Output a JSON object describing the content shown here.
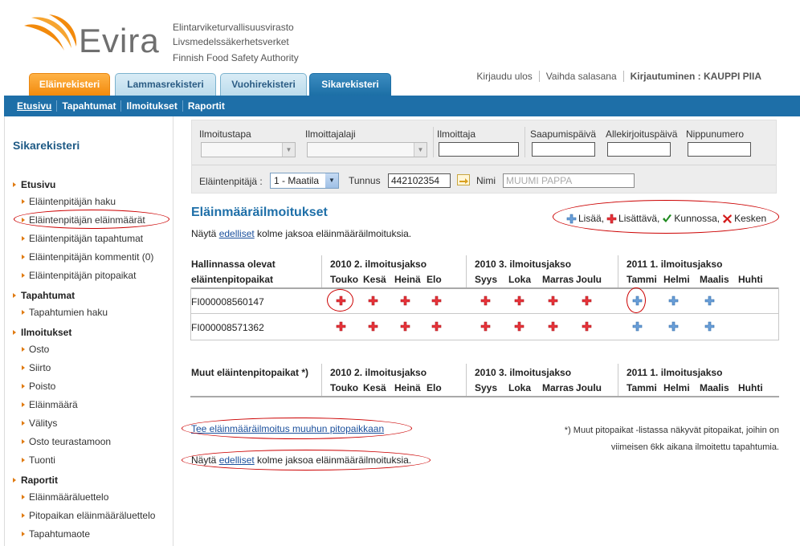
{
  "brand": {
    "logo_text": "Evira",
    "agency_fi": "Elintarviketurvallisuusvirasto",
    "agency_sv": "Livsmedelssäkerhetsverket",
    "agency_en": "Finnish Food Safety Authority",
    "colors": {
      "orange": "#f28a0c",
      "blue": "#1e6fa8",
      "gray": "#6f6f6f"
    }
  },
  "tabs": [
    "Eläinrekisteri",
    "Lammasrekisteri",
    "Vuohirekisteri",
    "Sikarekisteri"
  ],
  "toplinks": {
    "logout": "Kirjaudu ulos",
    "change_password": "Vaihda salasana",
    "login_info": "Kirjautuminen : KAUPPI PIIA"
  },
  "nav": [
    "Etusivu",
    "Tapahtumat",
    "Ilmoitukset",
    "Raportit"
  ],
  "sidebar": {
    "title": "Sikarekisteri",
    "sections": [
      {
        "label": "Etusivu",
        "items": [
          "Eläintenpitäjän haku",
          "Eläintenpitäjän eläinmäärät",
          "Eläintenpitäjän tapahtumat",
          "Eläintenpitäjän kommentit (0)",
          "Eläintenpitäjän pitopaikat"
        ]
      },
      {
        "label": "Tapahtumat",
        "items": [
          "Tapahtumien haku"
        ]
      },
      {
        "label": "Ilmoitukset",
        "items": [
          "Osto",
          "Siirto",
          "Poisto",
          "Eläinmäärä",
          "Välitys",
          "Osto teurastamoon",
          "Tuonti"
        ]
      },
      {
        "label": "Raportit",
        "items": [
          "Eläinmääräluettelo",
          "Pitopaikan eläinmääräluettelo",
          "Tapahtumaote"
        ]
      }
    ]
  },
  "filter": {
    "ilmoitustapa_label": "Ilmoitustapa",
    "ilmoittajalaji_label": "Ilmoittajalaji",
    "ilmoittaja_label": "Ilmoittaja",
    "saapumispaiva_label": "Saapumispäivä",
    "allekirjoituspaiva_label": "Allekirjoituspäivä",
    "nippunumero_label": "Nippunumero",
    "owner_label": "Eläintenpitäjä :",
    "owner_value": "1 - Maatila",
    "tunnus_label": "Tunnus",
    "tunnus_value": "442102354",
    "nimi_label": "Nimi",
    "nimi_value": "MUUMI PAPPA"
  },
  "main": {
    "title": "Eläinmääräilmoitukset",
    "show_prefix": "Näytä ",
    "show_link": "edelliset",
    "show_suffix": " kolme jaksoa eläinmääräilmoituksia.",
    "legend": {
      "add": "Lisää,",
      "supplement": "Lisättävä,",
      "ok": "Kunnossa,",
      "incomplete": "Kesken"
    },
    "table1_header": [
      "Hallinnassa olevat",
      "eläintenpitopaikat"
    ],
    "table2_header": "Muut eläintenpitopaikat *)",
    "periods": [
      {
        "title": "2010 2. ilmoitusjakso",
        "months": [
          "Touko",
          "Kesä",
          "Heinä",
          "Elo"
        ]
      },
      {
        "title": "2010 3. ilmoitusjakso",
        "months": [
          "Syys",
          "Loka",
          "Marras",
          "Joulu"
        ]
      },
      {
        "title": "2011 1. ilmoitusjakso",
        "months": [
          "Tammi",
          "Helmi",
          "Maalis",
          "Huhti"
        ]
      }
    ],
    "rows": [
      {
        "id": "FI000008560147",
        "status": [
          "red",
          "red",
          "red",
          "red",
          "red",
          "red",
          "red",
          "red",
          "blue",
          "blue",
          "blue",
          ""
        ]
      },
      {
        "id": "FI000008571362",
        "status": [
          "red",
          "red",
          "red",
          "red",
          "red",
          "red",
          "red",
          "red",
          "blue",
          "blue",
          "blue",
          ""
        ]
      }
    ],
    "other_link": "Tee eläinmääräilmoitus muuhun pitopaikkaan",
    "footnote_1": "*) Muut pitopaikat -listassa näkyvät pitopaikat, joihin on",
    "footnote_2": "viimeisen 6kk aikana ilmoitettu tapahtumia."
  }
}
